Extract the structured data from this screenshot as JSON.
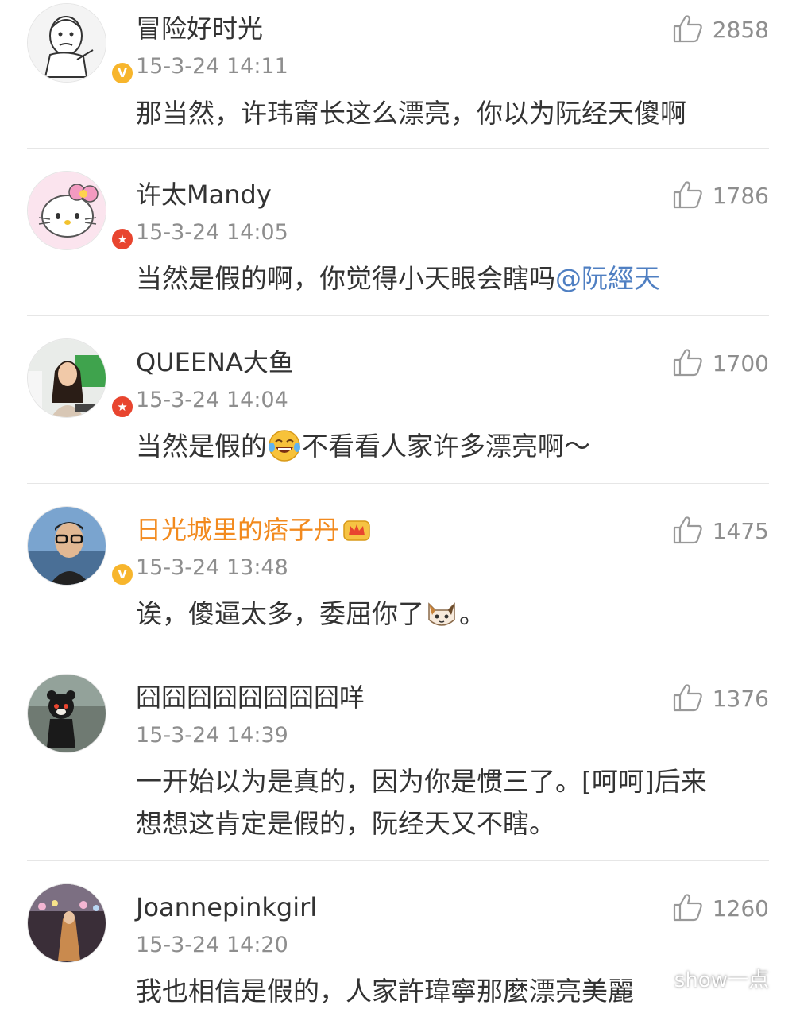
{
  "comments": [
    {
      "username": "冒险好时光",
      "time": "15-3-24 14:11",
      "likes": "2858",
      "badge": "V",
      "text": "那当然，许玮甯长这么漂亮，你以为阮经天傻啊"
    },
    {
      "username": "许太Mandy",
      "time": "15-3-24 14:05",
      "likes": "1786",
      "badge": "★",
      "text_before": "当然是假的啊，你觉得小天眼会瞎吗",
      "mention": "@阮經天"
    },
    {
      "username": "QUEENA大鱼",
      "time": "15-3-24 14:04",
      "likes": "1700",
      "badge": "★",
      "text_before": "当然是假的",
      "text_after": "不看看人家许多漂亮啊～"
    },
    {
      "username": "日光城里的痞子丹",
      "time": "15-3-24 13:48",
      "likes": "1475",
      "badge": "V",
      "text_before": "诶，傻逼太多，委屈你了",
      "text_after": "。"
    },
    {
      "username": "囧囧囧囧囧囧囧囧咩",
      "time": "15-3-24 14:39",
      "likes": "1376",
      "text_line1": "一开始以为是真的，因为你是惯三了。[呵呵]后来",
      "text_line2": "想想这肯定是假的，阮经天又不瞎。"
    },
    {
      "username": "Joannepinkgirl",
      "time": "15-3-24 14:20",
      "likes": "1260",
      "text": "我也相信是假的，人家許瑋寧那麼漂亮美麗"
    }
  ],
  "watermark": {
    "text": "show一点"
  },
  "colors": {
    "username": "#333333",
    "vip_username": "#f28a1e",
    "timestamp": "#8e8e8e",
    "mention": "#4f7fc2",
    "divider": "#e6e6e6",
    "badge_verified": "#f7b52c",
    "badge_star": "#e8452f"
  },
  "icons": {
    "like": "thumbs-up-outline-icon",
    "verified_badge": "verified-v-icon",
    "star_badge": "star-badge-icon",
    "laugh_emoji": "tears-of-joy-emoji",
    "cat_emoji": "cat-face-emoji",
    "vip_crown": "crown-icon",
    "watermark_logo": "wechat-logo-icon"
  }
}
